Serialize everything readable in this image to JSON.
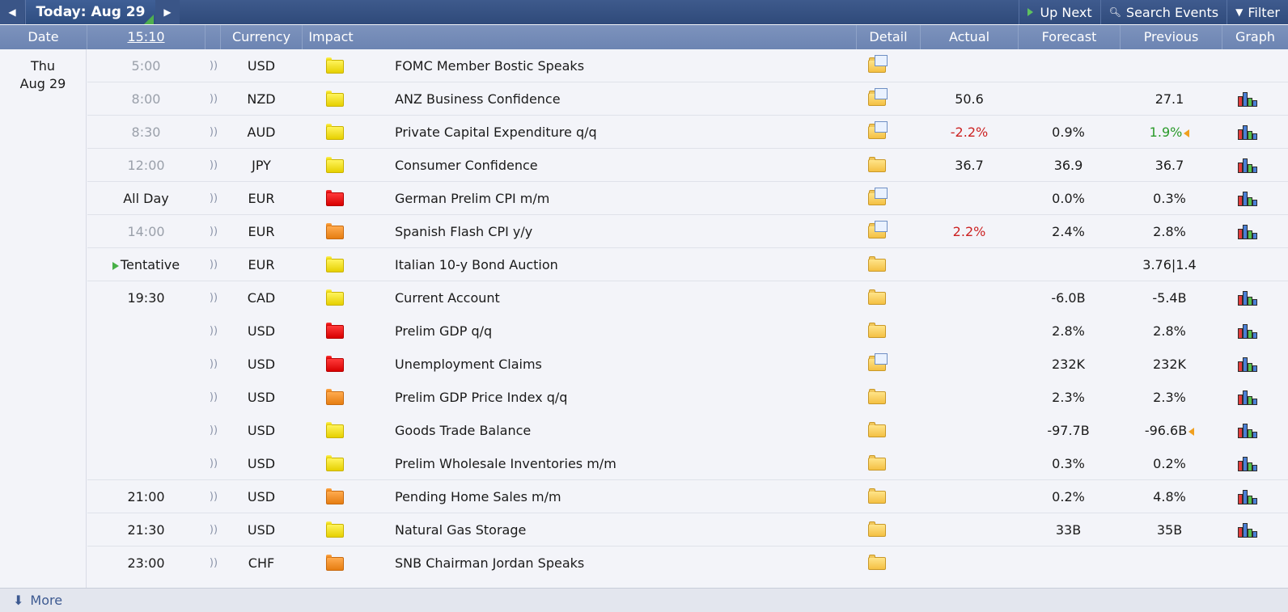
{
  "toolbar": {
    "prev_icon": "◀",
    "today_label": "Today: Aug 29",
    "next_icon": "▶",
    "up_next_label": "Up Next",
    "search_label": "Search Events",
    "filter_label": "Filter"
  },
  "columns": {
    "date": "Date",
    "time": "15:10",
    "currency": "Currency",
    "impact": "Impact",
    "detail": "Detail",
    "actual": "Actual",
    "forecast": "Forecast",
    "previous": "Previous",
    "graph": "Graph"
  },
  "date": {
    "weekday": "Thu",
    "day": "Aug 29"
  },
  "events": [
    {
      "time": "5:00",
      "currency": "USD",
      "impact": "yellow",
      "event": "FOMC Member Bostic Speaks",
      "detail": "folder-doc",
      "actual": "",
      "forecast": "",
      "previous": "",
      "graph": false
    },
    {
      "time": "8:00",
      "currency": "NZD",
      "impact": "yellow",
      "event": "ANZ Business Confidence",
      "detail": "folder-doc",
      "actual": "50.6",
      "forecast": "",
      "previous": "27.1",
      "graph": true
    },
    {
      "time": "8:30",
      "currency": "AUD",
      "impact": "yellow",
      "event": "Private Capital Expenditure q/q",
      "detail": "folder-doc",
      "actual": "-2.2%",
      "actual_color": "red",
      "forecast": "0.9%",
      "previous": "1.9%",
      "previous_color": "green",
      "revised": true,
      "graph": true
    },
    {
      "time": "12:00",
      "currency": "JPY",
      "impact": "yellow",
      "event": "Consumer Confidence",
      "detail": "folder",
      "actual": "36.7",
      "forecast": "36.9",
      "previous": "36.7",
      "graph": true
    },
    {
      "time": "All Day",
      "currency": "EUR",
      "impact": "red",
      "event": "German Prelim CPI m/m",
      "detail": "folder-doc",
      "actual": "",
      "forecast": "0.0%",
      "previous": "0.3%",
      "graph": true
    },
    {
      "time": "14:00",
      "currency": "EUR",
      "impact": "orange",
      "event": "Spanish Flash CPI y/y",
      "detail": "folder-doc",
      "actual": "2.2%",
      "actual_color": "red",
      "forecast": "2.4%",
      "previous": "2.8%",
      "graph": true
    },
    {
      "time": "Tentative",
      "currency": "EUR",
      "impact": "yellow",
      "event": "Italian 10-y Bond Auction",
      "detail": "folder",
      "actual": "",
      "forecast": "",
      "previous": "3.76|1.4",
      "graph": false
    },
    {
      "time": "19:30",
      "currency": "CAD",
      "impact": "yellow",
      "event": "Current Account",
      "detail": "folder",
      "actual": "",
      "forecast": "-6.0B",
      "previous": "-5.4B",
      "graph": true
    },
    {
      "time": "",
      "currency": "USD",
      "impact": "red",
      "event": "Prelim GDP q/q",
      "detail": "folder",
      "actual": "",
      "forecast": "2.8%",
      "previous": "2.8%",
      "graph": true
    },
    {
      "time": "",
      "currency": "USD",
      "impact": "red",
      "event": "Unemployment Claims",
      "detail": "folder-doc",
      "actual": "",
      "forecast": "232K",
      "previous": "232K",
      "graph": true
    },
    {
      "time": "",
      "currency": "USD",
      "impact": "orange",
      "event": "Prelim GDP Price Index q/q",
      "detail": "folder",
      "actual": "",
      "forecast": "2.3%",
      "previous": "2.3%",
      "graph": true
    },
    {
      "time": "",
      "currency": "USD",
      "impact": "yellow",
      "event": "Goods Trade Balance",
      "detail": "folder",
      "actual": "",
      "forecast": "-97.7B",
      "previous": "-96.6B",
      "revised": true,
      "graph": true
    },
    {
      "time": "",
      "currency": "USD",
      "impact": "yellow",
      "event": "Prelim Wholesale Inventories m/m",
      "detail": "folder",
      "actual": "",
      "forecast": "0.3%",
      "previous": "0.2%",
      "graph": true
    },
    {
      "time": "21:00",
      "currency": "USD",
      "impact": "orange",
      "event": "Pending Home Sales m/m",
      "detail": "folder",
      "actual": "",
      "forecast": "0.2%",
      "previous": "4.8%",
      "graph": true
    },
    {
      "time": "21:30",
      "currency": "USD",
      "impact": "yellow",
      "event": "Natural Gas Storage",
      "detail": "folder",
      "actual": "",
      "forecast": "33B",
      "previous": "35B",
      "graph": true
    },
    {
      "time": "23:00",
      "currency": "CHF",
      "impact": "orange",
      "event": "SNB Chairman Jordan Speaks",
      "detail": "folder",
      "actual": "",
      "forecast": "",
      "previous": "",
      "graph": false
    }
  ],
  "footer": {
    "more_label": "More",
    "more_icon": "⬇"
  },
  "colors": {
    "header_bg": "#2f4a7a",
    "subheader_bg": "#7089b5",
    "actual_red": "#cc2222",
    "previous_green": "#2a9a2a"
  }
}
